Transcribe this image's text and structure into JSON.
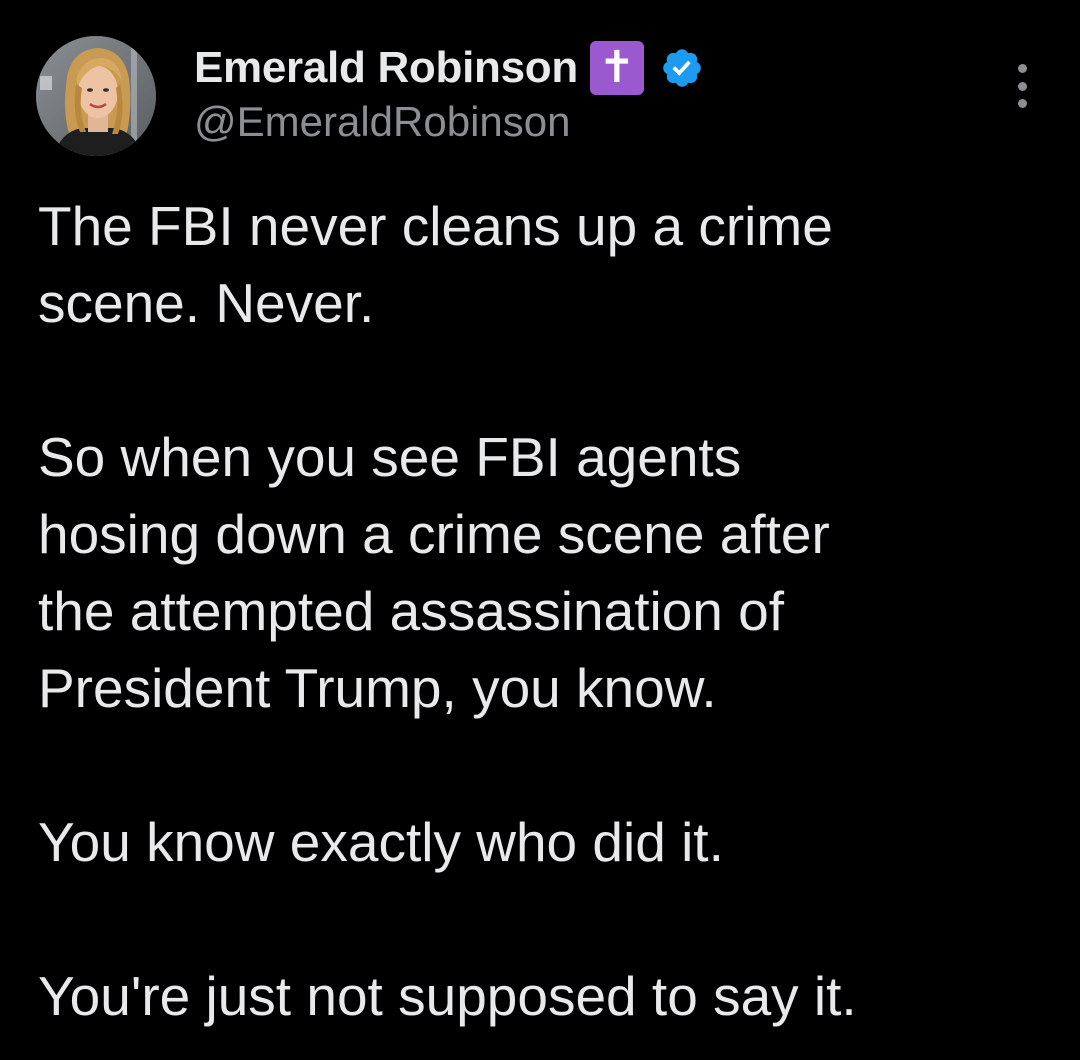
{
  "tweet": {
    "author": {
      "display_name": "Emerald Robinson",
      "name_emoji": "✝",
      "handle": "@EmeraldRobinson",
      "verified": true
    },
    "paragraphs": [
      "The FBI never cleans up a crime\nscene. Never.",
      "So when you see FBI agents\nhosing down a crime scene after\nthe attempted assassination of\nPresident Trump, you know.",
      "You know exactly who did it.",
      "You're just not supposed to say it."
    ]
  },
  "icons": {
    "verified": "verified-check-icon",
    "more": "more-options-icon"
  },
  "colors": {
    "background": "#000000",
    "primary_text": "#e7e9ea",
    "secondary_text": "#8b8f94",
    "verified_blue": "#1d9bf0",
    "emoji_purple": "#9b59d0"
  }
}
